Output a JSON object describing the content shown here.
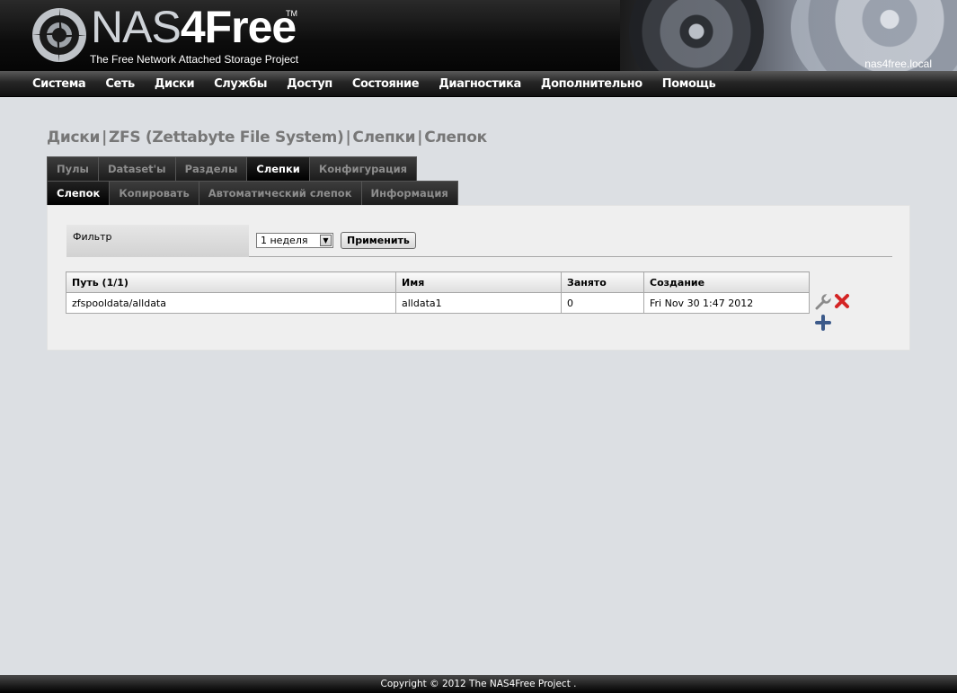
{
  "header": {
    "logo_nas": "NAS",
    "logo_free": "4Free",
    "logo_tm": "TM",
    "tagline": "The Free Network Attached Storage Project",
    "hostname": "nas4free.local"
  },
  "nav": {
    "items": [
      "Система",
      "Сеть",
      "Диски",
      "Службы",
      "Доступ",
      "Состояние",
      "Диагностика",
      "Дополнительно",
      "Помощь"
    ]
  },
  "breadcrumb": {
    "parts": [
      "Диски",
      "ZFS (Zettabyte File System)",
      "Слепки",
      "Слепок"
    ],
    "separator": "|"
  },
  "tabs_primary": [
    {
      "label": "Пулы",
      "active": false
    },
    {
      "label": "Dataset'ы",
      "active": false
    },
    {
      "label": "Разделы",
      "active": false
    },
    {
      "label": "Слепки",
      "active": true
    },
    {
      "label": "Конфигурация",
      "active": false
    }
  ],
  "tabs_secondary": [
    {
      "label": "Слепок",
      "active": true
    },
    {
      "label": "Копировать",
      "active": false
    },
    {
      "label": "Автоматический слепок",
      "active": false
    },
    {
      "label": "Информация",
      "active": false
    }
  ],
  "filter": {
    "label": "Фильтр",
    "selected": "1 неделя",
    "apply_label": "Применить"
  },
  "table": {
    "headers": [
      "Путь (1/1)",
      "Имя",
      "Занято",
      "Создание"
    ],
    "rows": [
      [
        "zfspooldata/alldata",
        "alldata1",
        "0",
        "Fri Nov 30 1:47 2012"
      ]
    ]
  },
  "icons": {
    "edit": "wrench-icon",
    "delete": "delete-x-icon",
    "add": "add-plus-icon"
  },
  "colors": {
    "delete": "#d42424",
    "add": "#3c5a8a",
    "page_background": "#dcdfe3"
  },
  "footer": {
    "copyright": "Copyright © 2012 The NAS4Free Project ."
  }
}
